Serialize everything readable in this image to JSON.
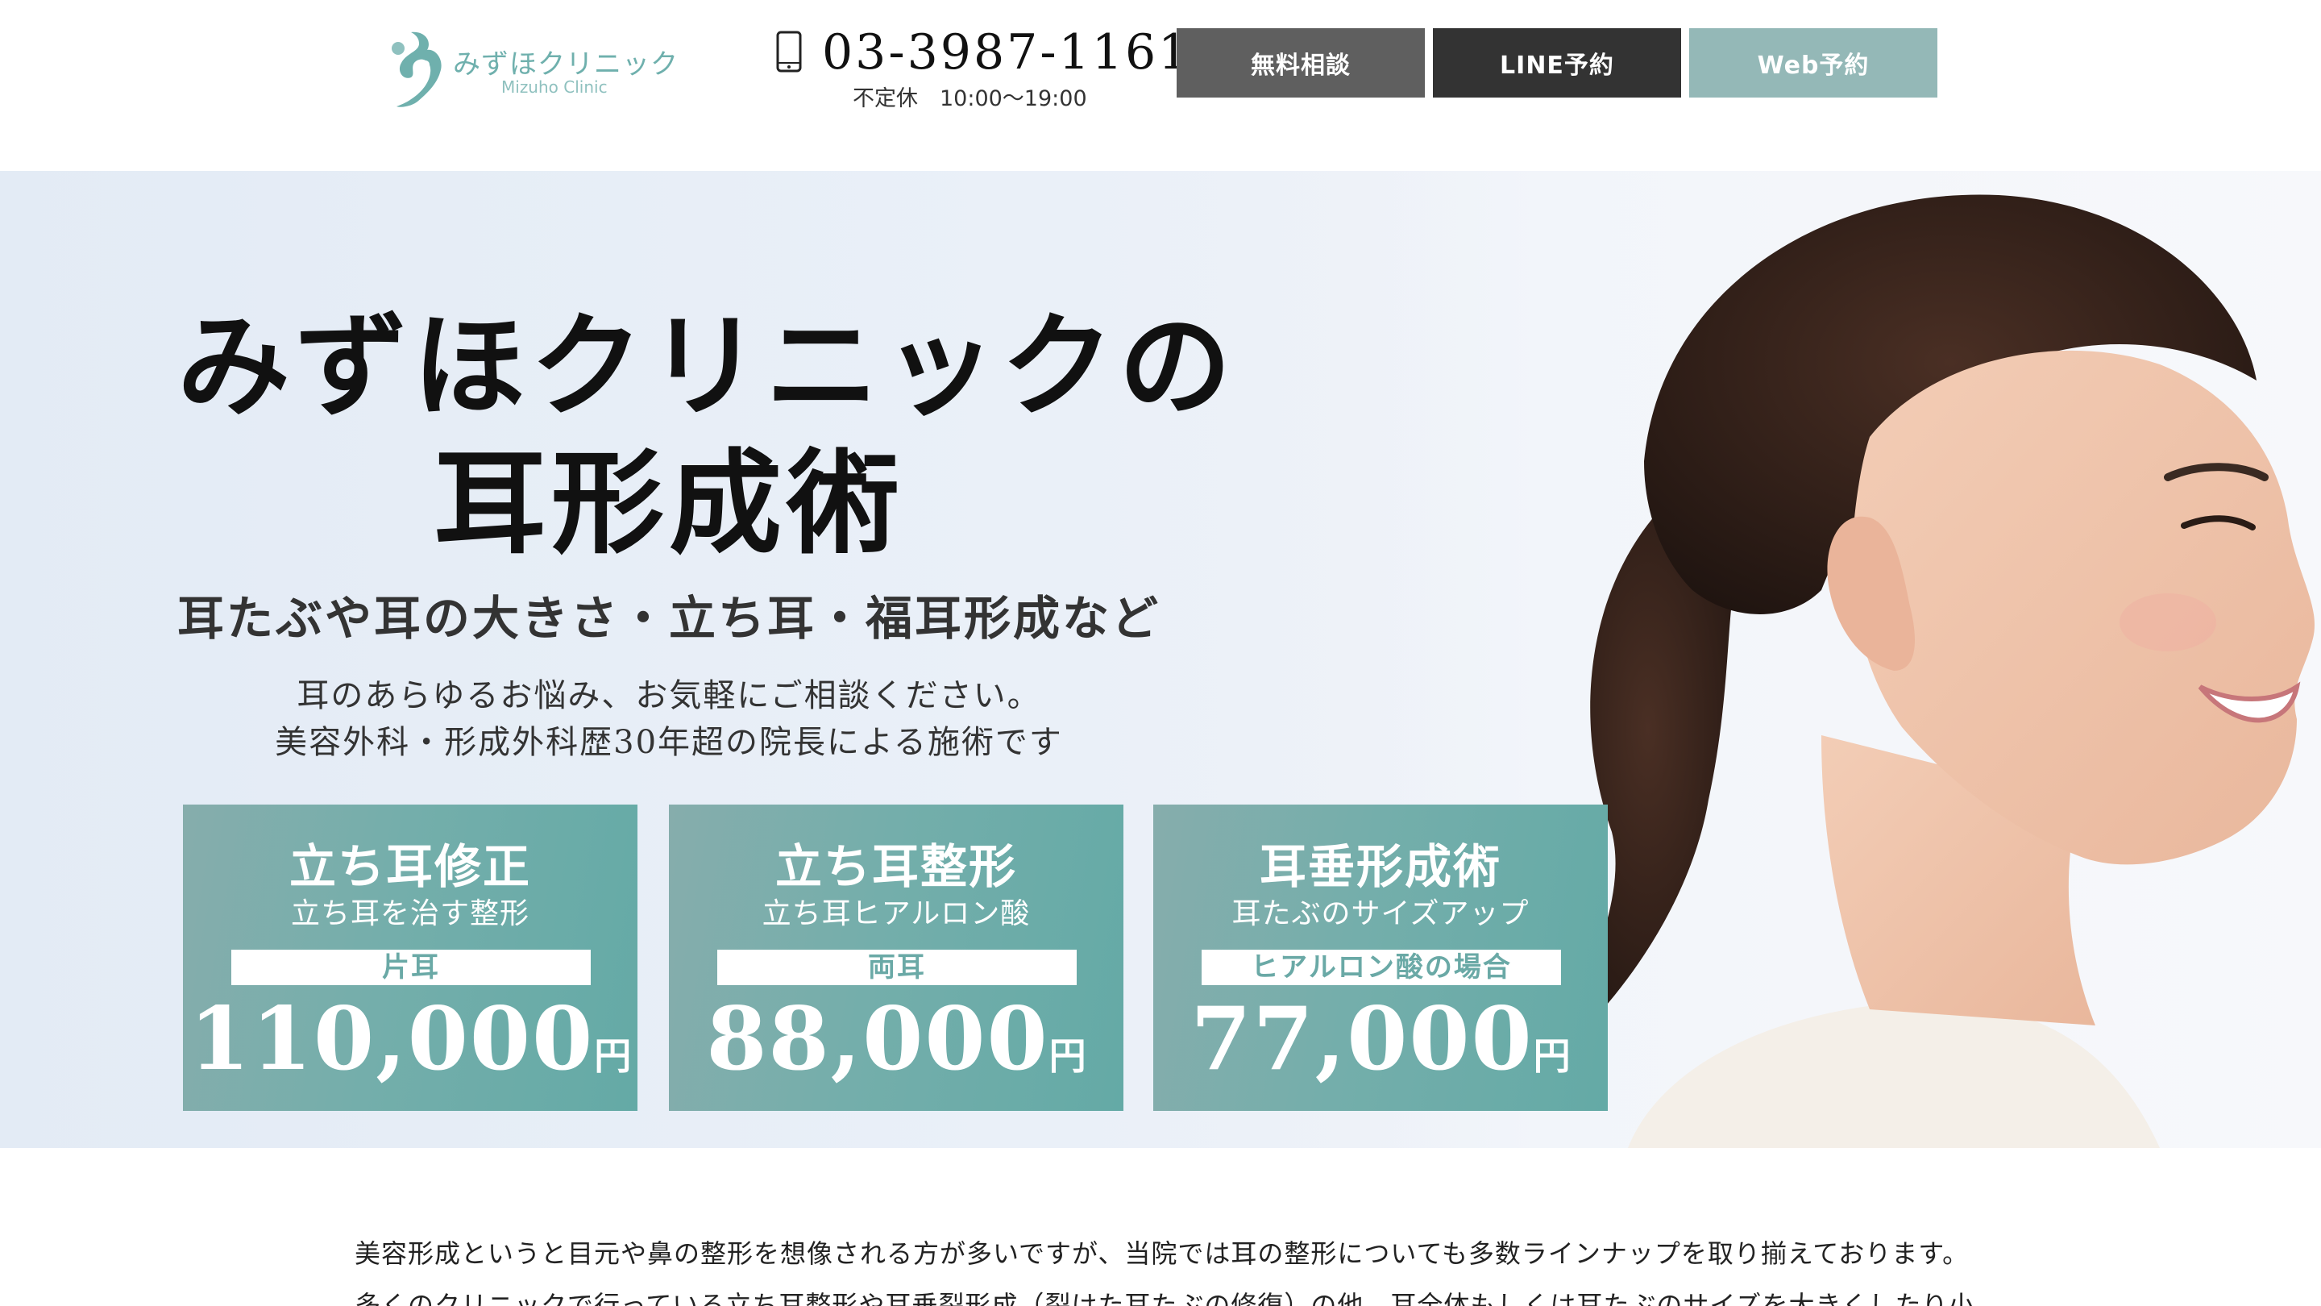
{
  "header": {
    "logo_jp": "みずほクリニック",
    "logo_en": "Mizuho Clinic",
    "phone_number": "03-3987-1161",
    "hours": "不定休　10:00〜19:00",
    "buttons": {
      "consult": "無料相談",
      "line": "LINE予約",
      "web": "Web予約"
    }
  },
  "hero": {
    "title_line1": "みずほクリニックの",
    "title_line2": "耳形成術",
    "subtitle": "耳たぶや耳の大きさ・立ち耳・福耳形成など",
    "desc_line1": "耳のあらゆるお悩み、お気軽にご相談ください。",
    "desc_line2": "美容外科・形成外科歴30年超の院長による施術です",
    "cards": [
      {
        "title": "立ち耳修正",
        "subtitle": "立ち耳を治す整形",
        "badge": "片耳",
        "price": "110,000",
        "unit": "円"
      },
      {
        "title": "立ち耳整形",
        "subtitle": "立ち耳ヒアルロン酸",
        "badge": "両耳",
        "price": "88,000",
        "unit": "円"
      },
      {
        "title": "耳垂形成術",
        "subtitle": "耳たぶのサイズアップ",
        "badge": "ヒアルロン酸の場合",
        "price": "77,000",
        "unit": "円"
      }
    ]
  },
  "intro": {
    "line1": "美容形成というと目元や鼻の整形を想像される方が多いですが、当院では耳の整形についても多数ラインナップを取り揃えております。",
    "line2": "多くのクリニックで行っている立ち耳整形や耳垂裂形成（裂けた耳たぶの修復）の他、耳全体もしくは耳たぶのサイズを大きくしたり小"
  },
  "colors": {
    "accent": "#6fb0ad",
    "card": "#6aa9a6",
    "btn_consult": "#5f5f5f",
    "btn_line": "#333333",
    "btn_web": "#94b8b7"
  }
}
